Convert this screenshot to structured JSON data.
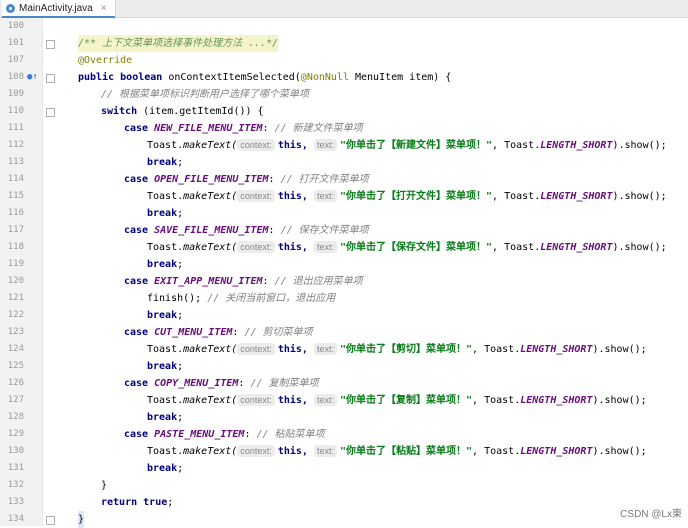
{
  "tab": {
    "filename": "MainActivity.java",
    "close": "×"
  },
  "watermark": "CSDN @Lx東",
  "lines": {
    "l100": "100",
    "l101": "101",
    "l107": "107",
    "l108": "108",
    "l109": "109",
    "l110": "110",
    "l111": "111",
    "l112": "112",
    "l113": "113",
    "l114": "114",
    "l115": "115",
    "l116": "116",
    "l117": "117",
    "l118": "118",
    "l119": "119",
    "l120": "120",
    "l121": "121",
    "l122": "122",
    "l123": "123",
    "l124": "124",
    "l125": "125",
    "l126": "126",
    "l127": "127",
    "l128": "128",
    "l129": "129",
    "l130": "130",
    "l131": "131",
    "l132": "132",
    "l133": "133",
    "l134": "134"
  },
  "code": {
    "javadoc": "/** 上下文菜单项选择事件处理方法 ...*/",
    "override": "@Override",
    "public": "public",
    "boolean": "boolean",
    "method": " onContextItemSelected(",
    "nonnull": "@NonNull",
    "menuitem": " MenuItem item) {",
    "comment1": "// 根据菜单项标识判断用户选择了哪个菜单项",
    "switch": "switch",
    "switch_expr": " (item.getItemId()) {",
    "case": "case",
    "break": "break",
    "return": "return",
    "true": "true",
    "this": "this,",
    "hint_context": "context:",
    "hint_text": "text:",
    "toast": "Toast.",
    "maketext": "makeText(",
    "toast_tail_a": ", Toast.",
    "length_short": "LENGTH_SHORT",
    "show": ").show();",
    "new_item": "NEW_FILE_MENU_ITEM",
    "new_comment": "// 新建文件菜单项",
    "new_str": "\"你单击了【新建文件】菜单项！\"",
    "open_item": "OPEN_FILE_MENU_ITEM",
    "open_comment": "// 打开文件菜单项",
    "open_str": "\"你单击了【打开文件】菜单项！\"",
    "save_item": "SAVE_FILE_MENU_ITEM",
    "save_comment": "// 保存文件菜单项",
    "save_str": "\"你单击了【保存文件】菜单项！\"",
    "exit_item": "EXIT_APP_MENU_ITEM",
    "exit_comment": "// 退出应用菜单项",
    "finish": "finish();",
    "finish_comment": " // 关闭当前窗口，退出应用",
    "cut_item": "CUT_MENU_ITEM",
    "cut_comment": "// 剪切菜单项",
    "cut_str": "\"你单击了【剪切】菜单项！\"",
    "copy_item": "COPY_MENU_ITEM",
    "copy_comment": "// 复制菜单项",
    "copy_str": "\"你单击了【复制】菜单项！\"",
    "paste_item": "PASTE_MENU_ITEM",
    "paste_comment": "// 粘贴菜单项",
    "paste_str": "\"你单击了【粘贴】菜单项！\"",
    "close_switch": "}",
    "close_method": "}"
  }
}
